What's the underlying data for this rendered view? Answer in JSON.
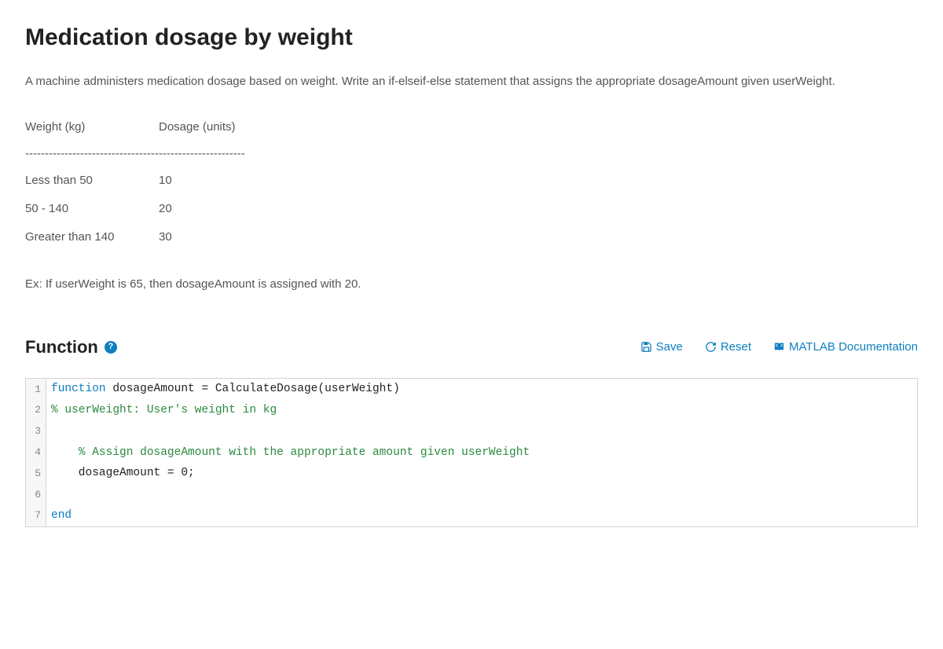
{
  "title": "Medication dosage by weight",
  "description": "A machine administers medication dosage based on weight. Write an if-elseif-else statement that assigns the appropriate dosageAmount given userWeight.",
  "table": {
    "header_col1": "Weight (kg)",
    "header_col2": "Dosage (units)",
    "divider": "--------------------------------------------------------",
    "rows": [
      {
        "col1": "Less than 50",
        "col2": "10"
      },
      {
        "col1": "50 - 140",
        "col2": "20"
      },
      {
        "col1": "Greater than 140",
        "col2": "30"
      }
    ]
  },
  "example": "Ex: If userWeight is 65, then dosageAmount is assigned with 20.",
  "section": {
    "heading": "Function",
    "help": "?"
  },
  "actions": {
    "save": "Save",
    "reset": "Reset",
    "documentation": "MATLAB Documentation"
  },
  "code": {
    "lines": [
      {
        "n": "1",
        "tokens": [
          {
            "cls": "tok-keyword",
            "t": "function"
          },
          {
            "cls": "tok-plain",
            "t": " dosageAmount = CalculateDosage(userWeight)"
          }
        ]
      },
      {
        "n": "2",
        "tokens": [
          {
            "cls": "tok-comment",
            "t": "% userWeight: User's weight in kg"
          }
        ]
      },
      {
        "n": "3",
        "tokens": [
          {
            "cls": "tok-plain",
            "t": ""
          }
        ]
      },
      {
        "n": "4",
        "tokens": [
          {
            "cls": "tok-plain",
            "t": "    "
          },
          {
            "cls": "tok-comment",
            "t": "% Assign dosageAmount with the appropriate amount given userWeight"
          }
        ]
      },
      {
        "n": "5",
        "tokens": [
          {
            "cls": "tok-plain",
            "t": "    dosageAmount = 0;"
          }
        ]
      },
      {
        "n": "6",
        "tokens": [
          {
            "cls": "tok-plain",
            "t": ""
          }
        ]
      },
      {
        "n": "7",
        "tokens": [
          {
            "cls": "tok-keyword",
            "t": "end"
          }
        ]
      }
    ]
  }
}
